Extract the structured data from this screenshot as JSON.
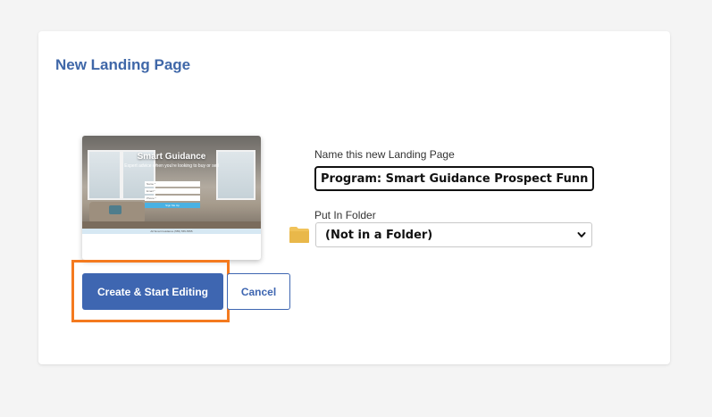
{
  "dialog": {
    "title": "New Landing Page"
  },
  "thumbnail": {
    "headline": "Smart Guidance",
    "subheadline": "Expert advice when you're looking to buy or sell",
    "fields": [
      "Name *",
      "Email *",
      "Phone *"
    ],
    "button_label": "Sign Me Up",
    "footer_text": "All Smart Guidance (555) 555-5555"
  },
  "form": {
    "name_label": "Name this new Landing Page",
    "name_value": "Program: Smart Guidance Prospect Funnel",
    "folder_label": "Put In Folder",
    "folder_selected": "(Not in a Folder)",
    "folder_icon": "folder-icon"
  },
  "actions": {
    "create_label": "Create & Start Editing",
    "cancel_label": "Cancel",
    "highlight_color": "#f47a1f",
    "primary_color": "#3e66b1"
  }
}
